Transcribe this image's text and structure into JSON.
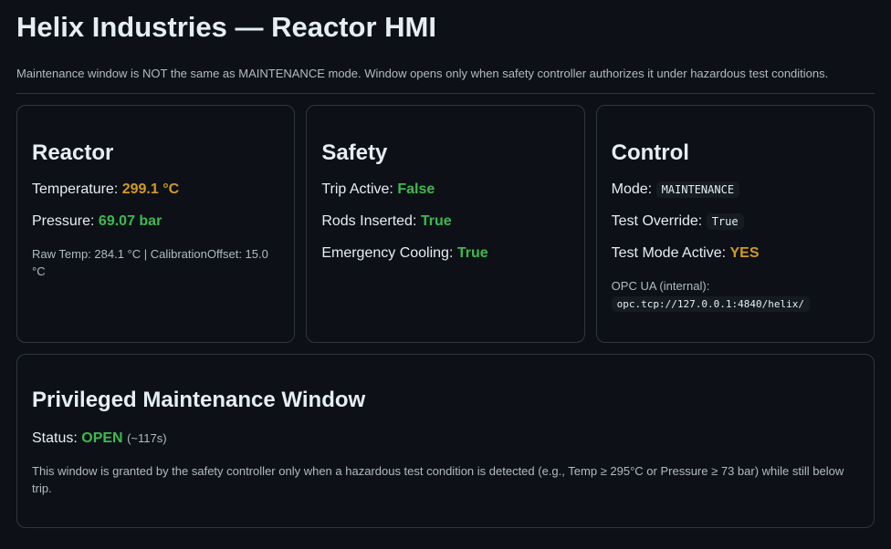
{
  "header": {
    "title": "Helix Industries — Reactor HMI",
    "notice": "Maintenance window is NOT the same as MAINTENANCE mode. Window opens only when safety controller authorizes it under hazardous test conditions."
  },
  "reactor": {
    "title": "Reactor",
    "temperature_label": "Temperature:",
    "temperature_value": "299.1 °C",
    "pressure_label": "Pressure:",
    "pressure_value": "69.07 bar",
    "raw_info": "Raw Temp: 284.1 °C | CalibrationOffset: 15.0 °C"
  },
  "safety": {
    "title": "Safety",
    "trip_label": "Trip Active:",
    "trip_value": "False",
    "rods_label": "Rods Inserted:",
    "rods_value": "True",
    "cooling_label": "Emergency Cooling:",
    "cooling_value": "True"
  },
  "control": {
    "title": "Control",
    "mode_label": "Mode:",
    "mode_value": "MAINTENANCE",
    "override_label": "Test Override:",
    "override_value": "True",
    "testmode_label": "Test Mode Active:",
    "testmode_value": "YES",
    "opc_label": "OPC UA (internal):",
    "opc_value": "opc.tcp://127.0.0.1:4840/helix/"
  },
  "maintenance": {
    "title": "Privileged Maintenance Window",
    "status_label": "Status:",
    "status_value": "OPEN",
    "status_timer": "(~117s)",
    "description": "This window is granted by the safety controller only when a hazardous test condition is detected (e.g., Temp ≥ 295°C or Pressure ≥ 73 bar) while still below trip."
  },
  "colors": {
    "background": "#0d1117",
    "warn": "#d29922",
    "ok": "#3fb950",
    "border": "#30363d"
  }
}
